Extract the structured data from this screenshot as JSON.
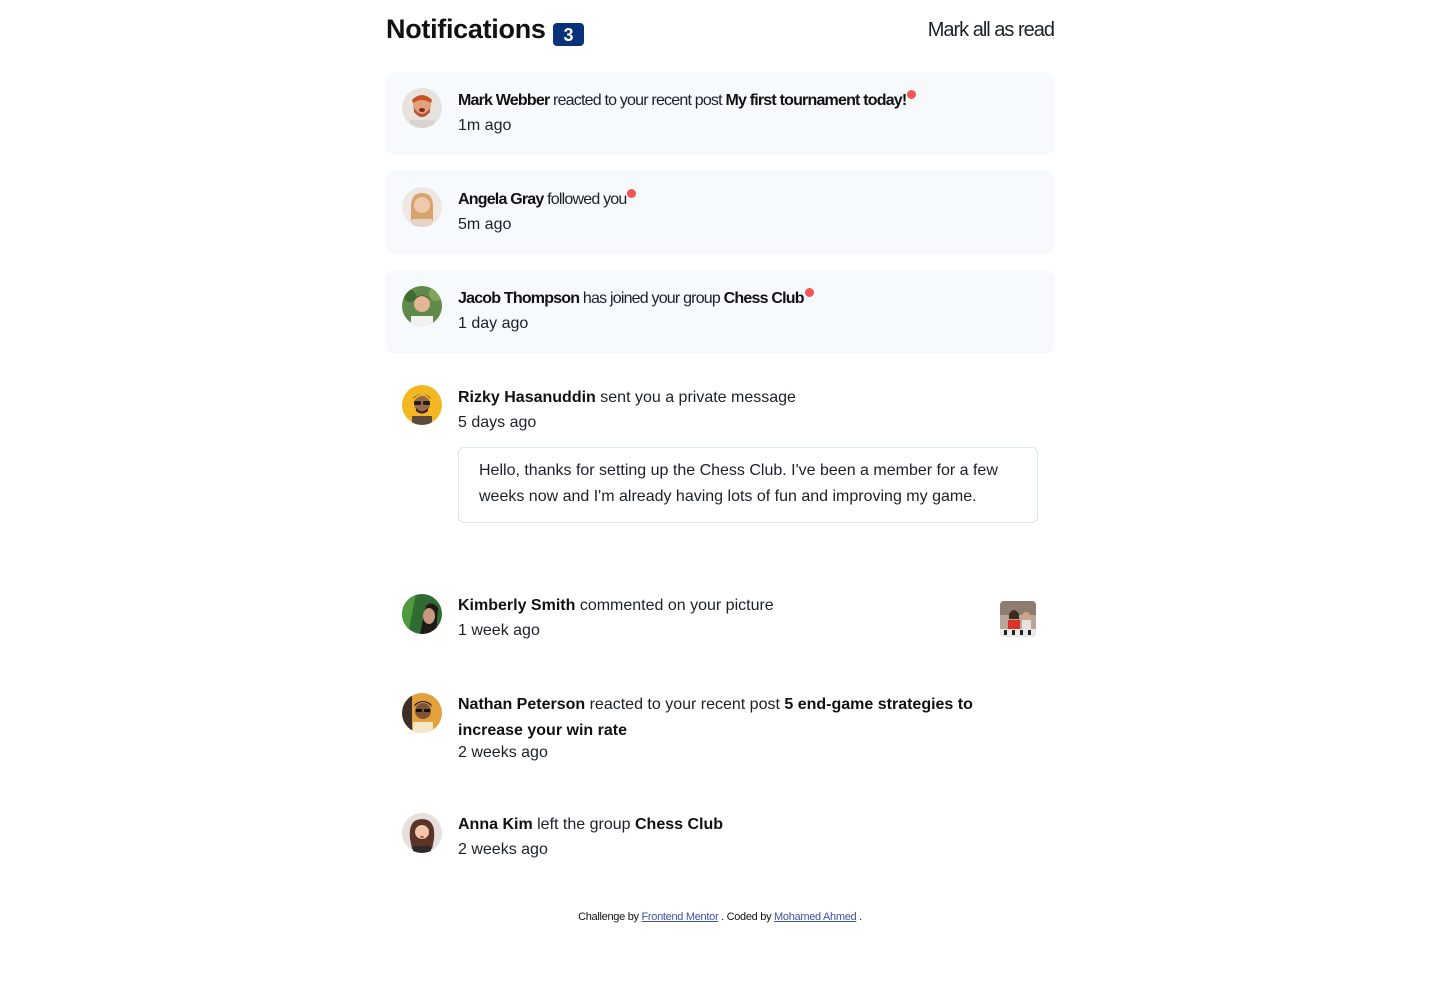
{
  "header": {
    "title": "Notifications",
    "count": "3",
    "mark_all_label": "Mark all as read"
  },
  "notifications": [
    {
      "name": "Mark Webber",
      "action": "reacted to your recent post",
      "target": "My first tournament today!",
      "time": "1m ago",
      "unread": true
    },
    {
      "name": "Angela Gray",
      "action": "followed you",
      "target": "",
      "time": "5m ago",
      "unread": true
    },
    {
      "name": "Jacob Thompson",
      "action": "has joined your group",
      "target": "Chess Club",
      "time": "1 day ago",
      "unread": true
    },
    {
      "name": "Rizky Hasanuddin",
      "action": "sent you a private message",
      "target": "",
      "time": "5 days ago",
      "unread": false,
      "message": "Hello, thanks for setting up the Chess Club. I've been a member for a few weeks now and I'm already having lots of fun and improving my game."
    },
    {
      "name": "Kimberly Smith",
      "action": "commented on your picture",
      "target": "",
      "time": "1 week ago",
      "unread": false
    },
    {
      "name": "Nathan Peterson",
      "action": "reacted to your recent post",
      "target": "5 end-game strategies to increase your win rate",
      "time": "2 weeks ago",
      "unread": false
    },
    {
      "name": "Anna Kim",
      "action": "left the group",
      "target": "Chess Club",
      "time": "2 weeks ago",
      "unread": false
    }
  ],
  "footer": {
    "prefix": "Challenge by",
    "link1": "Frontend Mentor",
    "middle": ". Coded by",
    "link2": "Mohamed Ahmed",
    "suffix": "."
  },
  "colors": {
    "accent_blue": "#0a327b",
    "unread_bg": "#f6fafd",
    "red_dot": "#f65552",
    "link": "#3e52a3"
  }
}
